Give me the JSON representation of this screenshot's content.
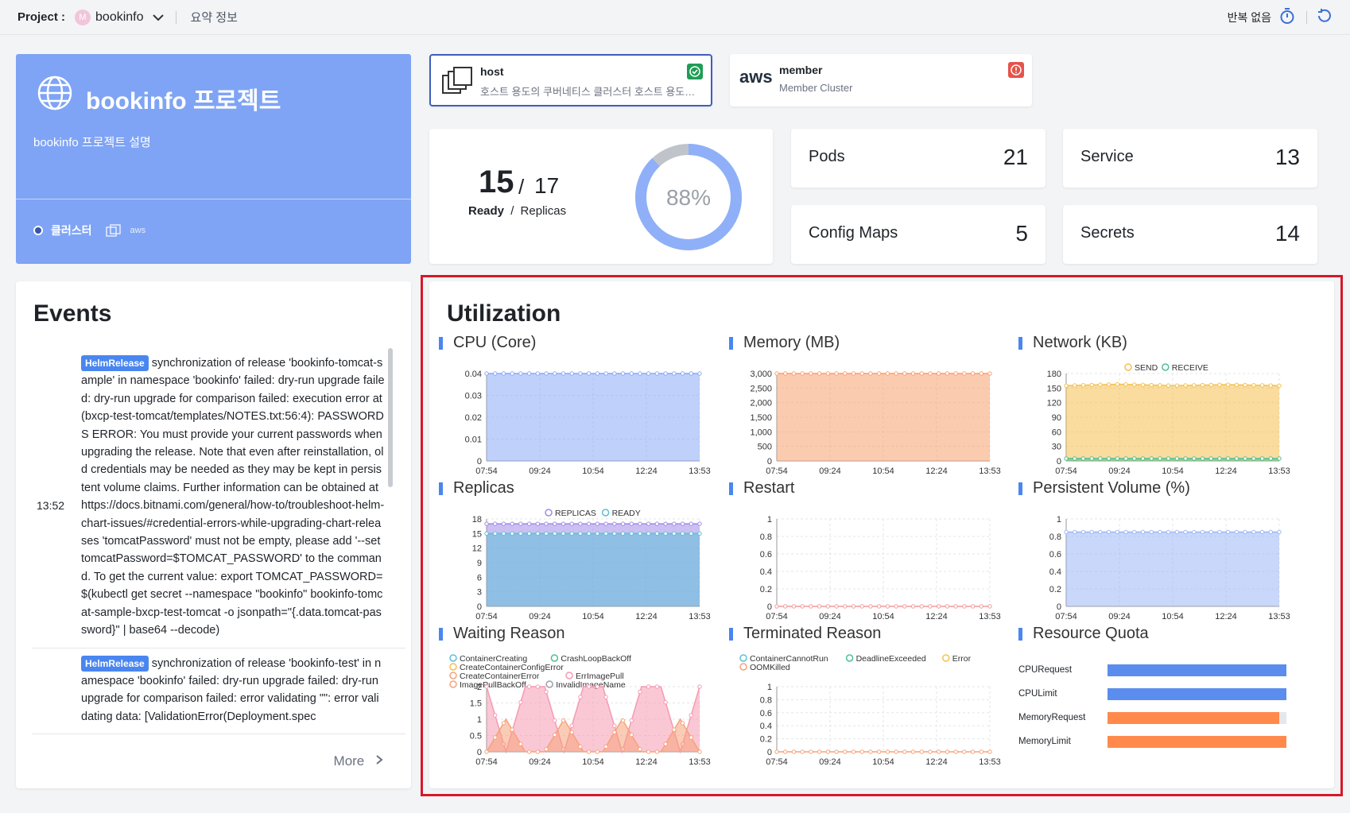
{
  "topbar": {
    "project_label": "Project :",
    "project_avatar": "M",
    "project_name": "bookinfo",
    "summary_link": "요약 정보",
    "repeat_label": "반복 없음",
    "icons": [
      "chevron-down-icon",
      "timer-icon",
      "refresh-icon"
    ]
  },
  "project_card": {
    "title": "bookinfo 프로젝트",
    "description": "bookinfo 프로젝트 설명",
    "clusters_label": "클러스터",
    "aws_label": "aws",
    "color": "#7fa4f5"
  },
  "clusters": [
    {
      "name": "host",
      "subtitle": "호스트 용도의 쿠버네티스 클러스터 호스트 용도의 클러스터",
      "status": "ok",
      "status_color": "#1f9d55"
    },
    {
      "name": "member",
      "subtitle": "Member Cluster",
      "provider": "aws",
      "status": "error",
      "status_color": "#e5534b"
    }
  ],
  "replicas": {
    "ready": "15",
    "separator": "/",
    "total": "17",
    "ready_label": "Ready",
    "label_separator": "/",
    "replicas_label": "Replicas",
    "percent_label": "88%",
    "percent": 88
  },
  "counts": {
    "pods": {
      "label": "Pods",
      "value": "21"
    },
    "service": {
      "label": "Service",
      "value": "13"
    },
    "config_maps": {
      "label": "Config Maps",
      "value": "5"
    },
    "secrets": {
      "label": "Secrets",
      "value": "14"
    }
  },
  "events": {
    "title": "Events",
    "more_label": "More",
    "items": [
      {
        "time": "13:52",
        "tag": "HelmRelease",
        "text": "synchronization of release 'bookinfo-tomcat-sample' in namespace 'bookinfo' failed: dry-run upgrade failed: dry-run upgrade for comparison failed: execution error at (bxcp-test-tomcat/templates/NOTES.txt:56:4): PASSWORDS ERROR: You must provide your current passwords when upgrading the release. Note that even after reinstallation, old credentials may be needed as they may be kept in persistent volume claims. Further information can be obtained at https://docs.bitnami.com/general/how-to/troubleshoot-helm-chart-issues/#credential-errors-while-upgrading-chart-releases 'tomcatPassword' must not be empty, please add '--set tomcatPassword=$TOMCAT_PASSWORD' to the command. To get the current value: export TOMCAT_PASSWORD=$(kubectl get secret --namespace \"bookinfo\" bookinfo-tomcat-sample-bxcp-test-tomcat -o jsonpath=\"{.data.tomcat-password}\" | base64 --decode)"
      },
      {
        "time": "",
        "tag": "HelmRelease",
        "text": "synchronization of release 'bookinfo-test' in namespace 'bookinfo' failed: dry-run upgrade failed: dry-run upgrade for comparison failed: error validating \"\": error validating data: [ValidationError(Deployment.spec"
      }
    ]
  },
  "utilization": {
    "title": "Utilization",
    "x_ticks": [
      "07:54",
      "09:24",
      "10:54",
      "12:24",
      "13:53"
    ],
    "panels": {
      "cpu": {
        "title": "CPU (Core)"
      },
      "memory": {
        "title": "Memory (MB)"
      },
      "network": {
        "title": "Network (KB)"
      },
      "replicas": {
        "title": "Replicas"
      },
      "restart": {
        "title": "Restart"
      },
      "pv": {
        "title": "Persistent Volume (%)"
      },
      "waiting": {
        "title": "Waiting Reason"
      },
      "terminated": {
        "title": "Terminated Reason"
      },
      "quota": {
        "title": "Resource Quota"
      }
    }
  },
  "chart_data": [
    {
      "type": "area",
      "title": "CPU (Core)",
      "ylim": [
        0,
        0.04
      ],
      "y_ticks": [
        "0.04",
        "0.03",
        "0.02",
        "0.01",
        "0"
      ],
      "series": [
        {
          "values": [
            0.04,
            0.04,
            0.04,
            0.04,
            0.04
          ],
          "color": "#8aaaf5"
        }
      ]
    },
    {
      "type": "area",
      "title": "Memory (MB)",
      "ylim": [
        0,
        3000
      ],
      "y_ticks": [
        "3,000",
        "2,500",
        "2,000",
        "1,500",
        "1,000",
        "500",
        "0"
      ],
      "series": [
        {
          "values": [
            3000,
            3000,
            3000,
            3000,
            3000
          ],
          "color": "#f7a070"
        }
      ]
    },
    {
      "type": "area",
      "title": "Network (KB)",
      "ylim": [
        0,
        180
      ],
      "y_ticks": [
        "180",
        "150",
        "120",
        "90",
        "60",
        "30",
        "0"
      ],
      "series": [
        {
          "name": "SEND",
          "values": [
            155,
            158,
            155,
            157,
            155
          ],
          "color": "#f5c04f"
        },
        {
          "name": "RECEIVE",
          "values": [
            5,
            5,
            5,
            5,
            5
          ],
          "color": "#4ec08f"
        }
      ]
    },
    {
      "type": "area",
      "title": "Replicas",
      "ylim": [
        0,
        18
      ],
      "y_ticks": [
        "18",
        "15",
        "12",
        "9",
        "6",
        "3",
        "0"
      ],
      "series": [
        {
          "name": "REPLICAS",
          "values": [
            17,
            17,
            17,
            17,
            17
          ],
          "color": "#a28ae8"
        },
        {
          "name": "READY",
          "values": [
            15,
            15,
            15,
            15,
            15
          ],
          "color": "#5cc0d8"
        }
      ]
    },
    {
      "type": "line",
      "title": "Restart",
      "ylim": [
        0,
        1
      ],
      "y_ticks": [
        "1",
        "0.8",
        "0.6",
        "0.4",
        "0.2",
        "0"
      ],
      "series": [
        {
          "values": [
            0,
            0,
            0,
            0,
            0
          ],
          "color": "#f39a9a"
        }
      ]
    },
    {
      "type": "area",
      "title": "Persistent Volume (%)",
      "ylim": [
        0,
        1
      ],
      "y_ticks": [
        "1",
        "0.8",
        "0.6",
        "0.4",
        "0.2",
        "0"
      ],
      "series": [
        {
          "values": [
            0.85,
            0.85,
            0.85,
            0.85,
            0.85
          ],
          "color": "#9bb7f5"
        }
      ]
    },
    {
      "type": "area",
      "title": "Waiting Reason",
      "ylim": [
        0,
        2
      ],
      "y_ticks": [
        "2",
        "1.5",
        "1",
        "0.5",
        "0"
      ],
      "legend": [
        "ContainerCreating",
        "CrashLoopBackOff",
        "CreateContainerConfigError",
        "CreateContainerError",
        "ErrImagePull",
        "ImagePullBackOff",
        "InvalidImageName"
      ],
      "series": [
        {
          "name": "ErrImagePull",
          "values": [
            2,
            0,
            2,
            2,
            0,
            2,
            2,
            0,
            2,
            2,
            0,
            2
          ],
          "color": "#f59ab2"
        },
        {
          "name": "ImagePullBackOff",
          "values": [
            0,
            1,
            0,
            0,
            1,
            0,
            0,
            1,
            0,
            0,
            1,
            0
          ],
          "color": "#f5a37a"
        }
      ]
    },
    {
      "type": "line",
      "title": "Terminated Reason",
      "ylim": [
        0,
        1
      ],
      "y_ticks": [
        "1",
        "0.8",
        "0.6",
        "0.4",
        "0.2",
        "0"
      ],
      "legend": [
        "ContainerCannotRun",
        "DeadlineExceeded",
        "Error",
        "OOMKilled"
      ],
      "series": [
        {
          "values": [
            0,
            0,
            0,
            0,
            0
          ],
          "color": "#f5a37a"
        }
      ]
    },
    {
      "type": "bar",
      "title": "Resource Quota",
      "xlim": [
        0,
        1
      ],
      "categories": [
        "CPURequest",
        "CPULimit",
        "MemoryRequest",
        "MemoryLimit"
      ],
      "values": [
        1.0,
        1.0,
        0.96,
        1.0
      ],
      "colors": [
        "#5b8def",
        "#5b8def",
        "#ff8a4c",
        "#ff8a4c"
      ]
    }
  ]
}
